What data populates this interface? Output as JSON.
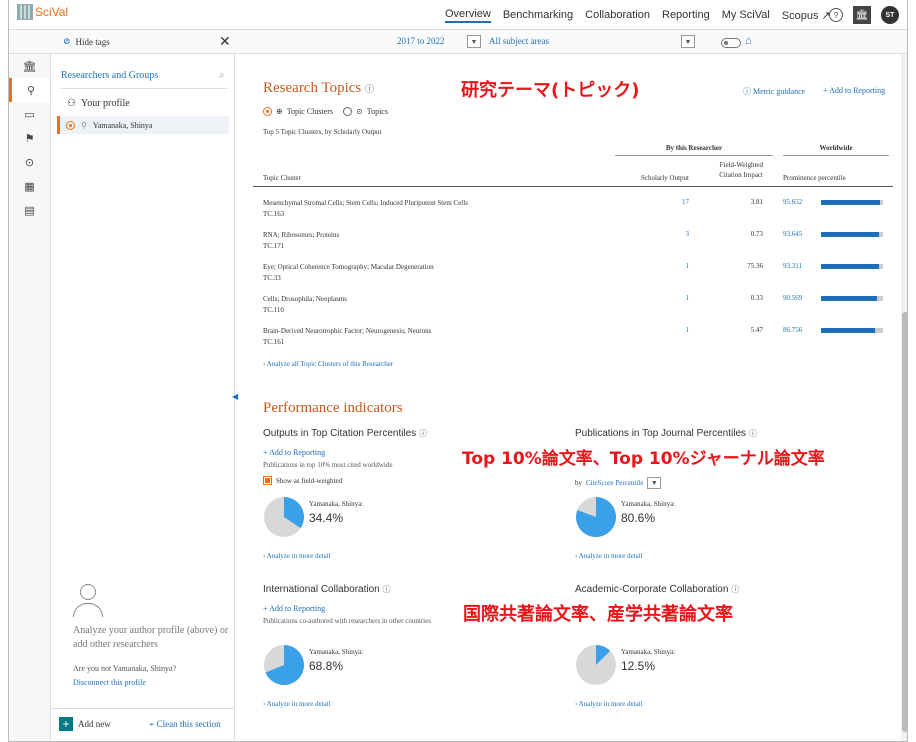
{
  "app": {
    "name": "SciVal"
  },
  "nav": {
    "items": [
      "Overview",
      "Benchmarking",
      "Collaboration",
      "Reporting",
      "My SciVal",
      "Scopus ↗"
    ],
    "active": "Overview"
  },
  "topbar": {
    "help": "?",
    "inst": "🏛",
    "user_initials": "ST"
  },
  "filters": {
    "hide_tags": "Hide tags",
    "close": "✕",
    "years": "2017 to 2022",
    "subject": "All subject areas"
  },
  "rail": {
    "icons": [
      "institution-icon",
      "person-icon",
      "document-icon",
      "flag-icon",
      "target-icon",
      "grid-icon",
      "report-icon"
    ]
  },
  "left_panel": {
    "title": "Researchers and Groups",
    "your_profile": "Your profile",
    "selected": "Yamanaka, Shinya",
    "analyze_text": "Analyze your author profile (above) or add other researchers",
    "not_user": "Are you not Yamanaka, Shinya?",
    "disconnect": "Disconnect this profile",
    "add_new": "Add new",
    "clean": "Clean this section"
  },
  "research_topics": {
    "title": "Research Topics",
    "annotation_jp": "研究テーマ(トピック)",
    "metric_guidance": "Metric guidance",
    "add_to_reporting": "+ Add to Reporting",
    "radio_clusters": "Topic Clusters",
    "radio_topics": "Topics",
    "subtitle": "Top 5 Topic Clusters, by Scholarly Output",
    "group_researcher": "By this Researcher",
    "group_worldwide": "Worldwide",
    "col_topic": "Topic Cluster",
    "col_so": "Scholarly Output",
    "col_fwci": "Field-Weighted Citation Impact",
    "col_prom": "Prominence percentile",
    "rows": [
      {
        "name": "Mesenchymal Stromal Cells; Stem Cells; Induced Pluripotent Stem Cells",
        "id": "TC.163",
        "so": "17",
        "fwci": "3.81",
        "prom": "95.652",
        "prom_val": 95.652
      },
      {
        "name": "RNA; Ribosomes; Proteins",
        "id": "TC.171",
        "so": "3",
        "fwci": "0.73",
        "prom": "93.645",
        "prom_val": 93.645
      },
      {
        "name": "Eye; Optical Coherence Tomography; Macular Degeneration",
        "id": "TC.33",
        "so": "1",
        "fwci": "75.36",
        "prom": "93.311",
        "prom_val": 93.311
      },
      {
        "name": "Cells; Drosophila; Neoplasms",
        "id": "TC.110",
        "so": "1",
        "fwci": "0.33",
        "prom": "90.569",
        "prom_val": 90.569
      },
      {
        "name": "Brain-Derived Neurotrophic Factor; Neurogenesis; Neurons",
        "id": "TC.161",
        "so": "1",
        "fwci": "5.47",
        "prom": "86.756",
        "prom_val": 86.756
      }
    ],
    "analyze_all": "Analyze all Topic Clusters of this Researcher"
  },
  "performance": {
    "title": "Performance indicators",
    "annotation_jp_top": "Top 10%論文率、Top 10%ジャーナル論文率",
    "annotation_jp_collab": "国際共著論文率、産学共著論文率",
    "cards": [
      {
        "title": "Outputs in Top Citation Percentiles",
        "add": "+ Add to Reporting",
        "desc": "Publications in top 10% most cited worldwide",
        "option": "Show as field-weighted",
        "name": "Yamanaka, Shinya:",
        "value": "34.4%",
        "fraction": 0.344,
        "more": "Analyze in more detail"
      },
      {
        "title": "Publications in Top Journal Percentiles",
        "by": "by",
        "by_link": "CiteScore Percentile",
        "name": "Yamanaka, Shinya:",
        "value": "80.6%",
        "fraction": 0.806,
        "more": "Analyze in more detail"
      },
      {
        "title": "International Collaboration",
        "add": "+ Add to Reporting",
        "desc": "Publications co-authored with researchers in other countries",
        "name": "Yamanaka, Shinya:",
        "value": "68.8%",
        "fraction": 0.688,
        "more": "Analyze in more detail"
      },
      {
        "title": "Academic-Corporate Collaboration",
        "name": "Yamanaka, Shinya:",
        "value": "12.5%",
        "fraction": 0.125,
        "more": "Analyze in more detail"
      }
    ]
  },
  "colors": {
    "accent": "#e9711c",
    "link": "#1e6fb8",
    "title": "#c75a1a",
    "annotation": "#e8161a",
    "pie_fill": "#3aa0e8",
    "pie_bg": "#d8d8d8"
  }
}
